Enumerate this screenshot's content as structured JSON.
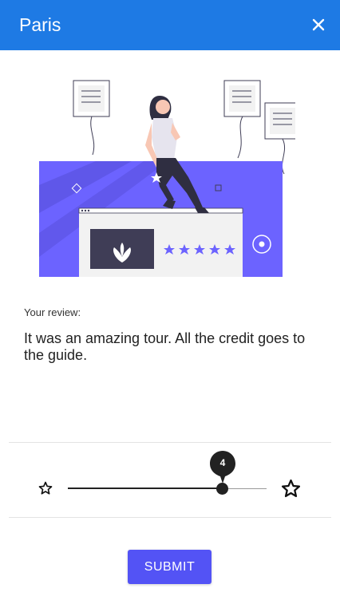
{
  "header": {
    "title": "Paris",
    "close_icon": "close-icon"
  },
  "review": {
    "label": "Your review:",
    "text": "It was an amazing tour. All the credit goes to the guide."
  },
  "rating": {
    "value": "4",
    "min_icon": "star-outline-icon",
    "max_icon": "star-outline-icon",
    "fraction": 0.8
  },
  "submit_label": "SUBMIT",
  "colors": {
    "header": "#1e7ae4",
    "accent": "#5353f5",
    "illustration": "#6c63ff"
  }
}
